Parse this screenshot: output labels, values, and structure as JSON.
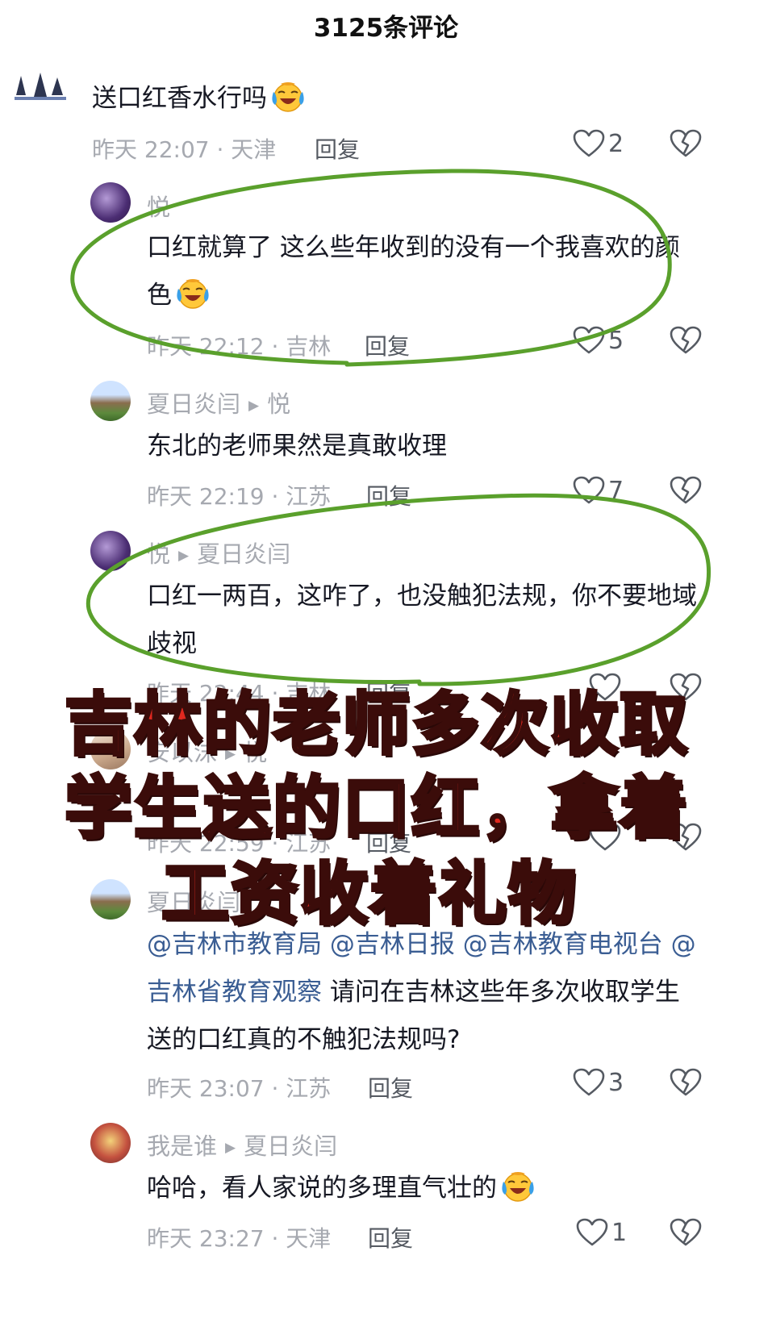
{
  "header": {
    "title": "3125条评论"
  },
  "comments": [
    {
      "author": "",
      "text": "送口红香水行吗",
      "time_location": "昨天 22:07 · 天津",
      "reply": "回复",
      "likes": "2"
    },
    {
      "author": "悦",
      "text": "口红就算了 这么些年收到的没有一个我喜欢的颜色",
      "time_location": "昨天 22:12 · 吉林",
      "reply": "回复",
      "likes": "5"
    },
    {
      "author": "夏日炎闫",
      "reply_to": "悦",
      "text": "东北的老师果然是真敢收理",
      "time_location": "昨天 22:19 · 江苏",
      "reply": "回复",
      "likes": "7"
    },
    {
      "author": "悦",
      "reply_to": "夏日炎闫",
      "text": "口红一两百，这咋了，也没触犯法规，你不要地域歧视",
      "time_location": "昨天 22:44 · 吉林",
      "reply": "回复"
    },
    {
      "author": "安以沫",
      "reply_to": "悦",
      "text": "",
      "time_location": "昨天 22:59 · 江苏",
      "reply": "回复"
    },
    {
      "author": "夏日炎闫",
      "mentions": [
        "@吉林市教育局",
        "@吉林日报",
        "@吉林教育电视台",
        "@吉林省教育观察"
      ],
      "text": "请问在吉林这些年多次收取学生送的口红真的不触犯法规吗?",
      "time_location": "昨天 23:07 · 江苏",
      "reply": "回复",
      "likes": "3"
    },
    {
      "author": "我是谁",
      "reply_to": "夏日炎闫",
      "text": "哈哈，看人家说的多理直气壮的",
      "time_location": "昨天 23:27 · 天津",
      "reply": "回复",
      "likes": "1"
    }
  ],
  "overlay_caption": {
    "line1": "吉林的老师多次收取",
    "line2": "学生送的口红，拿着",
    "line3": "工资收着礼物"
  },
  "colors": {
    "caption_red": "#e1281f",
    "circle_green": "#5aa02c",
    "mention_blue": "#3a5d93",
    "meta_gray": "#a6a9b0"
  },
  "icons": [
    "heart-icon",
    "broken-heart-icon",
    "laughing-crying-emoji",
    "play-arrow-icon"
  ]
}
